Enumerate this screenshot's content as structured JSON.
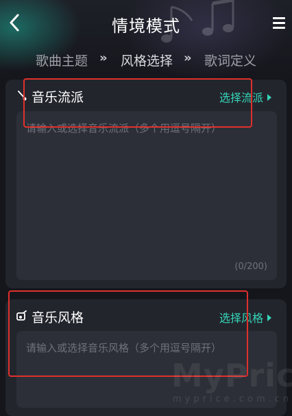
{
  "header": {
    "title": "情境模式",
    "back_icon": "chevron-left-icon",
    "menu_icon": "menu-icon"
  },
  "steps": {
    "items": [
      "歌曲主题",
      "风格选择",
      "歌词定义"
    ],
    "active_index": 1,
    "separator": "»"
  },
  "genre": {
    "title": "音乐流派",
    "icon": "music-note-icon",
    "action": "选择流派",
    "placeholder": "请输入或选择音乐流派（多个用逗号隔开）",
    "counter": "(0/200)"
  },
  "style": {
    "title": "音乐风格",
    "icon": "music-style-icon",
    "action": "选择风格",
    "placeholder": "请输入或选择音乐风格（多个用逗号隔开）"
  },
  "watermark": {
    "text": "MyPrice",
    "sub": "myprice.com.cn"
  },
  "colors": {
    "accent": "#35d6b8",
    "background": "#15161c",
    "card": "#23252d",
    "annotation": "#e0302c"
  }
}
